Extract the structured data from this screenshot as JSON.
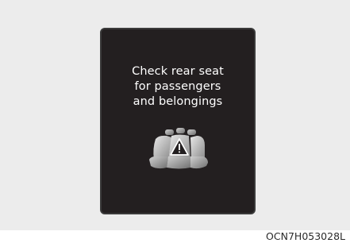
{
  "display": {
    "message_lines": [
      "Check rear seat",
      "for passengers",
      "and belongings"
    ],
    "icon": "rear-seat-warning-icon",
    "background_color": "#231f20",
    "text_color": "#ffffff"
  },
  "caption": "OCN7H053028L"
}
